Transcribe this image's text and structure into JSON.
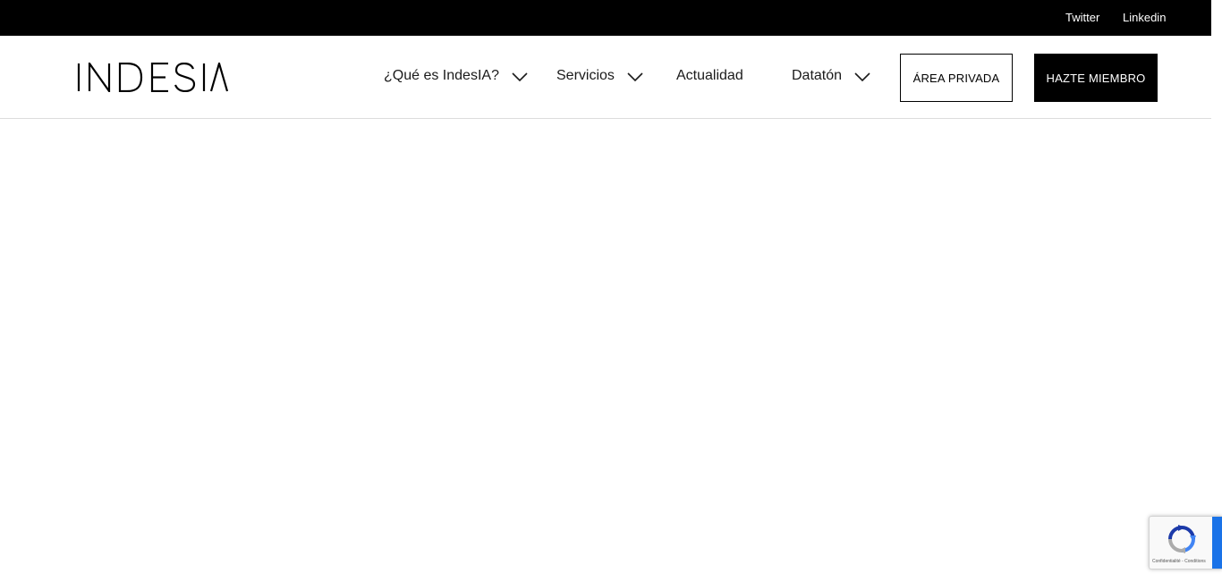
{
  "topbar": {
    "links": [
      {
        "label": "Twitter"
      },
      {
        "label": "Linkedin"
      }
    ]
  },
  "header": {
    "logo_text": "INDESIA",
    "nav": [
      {
        "label": "¿Qué es IndesIA?",
        "has_dropdown": true
      },
      {
        "label": "Servicios",
        "has_dropdown": true
      },
      {
        "label": "Actualidad",
        "has_dropdown": false
      },
      {
        "label": "Datatón",
        "has_dropdown": true
      }
    ],
    "buttons": {
      "private_area": "ÁREA PRIVADA",
      "become_member": "HAZTE MIEMBRO"
    }
  },
  "recaptcha": {
    "terms": "Confidentialité - Conditions"
  },
  "colors": {
    "topbar_bg": "#000000",
    "text": "#1a1a1a",
    "recaptcha_blue": "#1a73e8"
  }
}
